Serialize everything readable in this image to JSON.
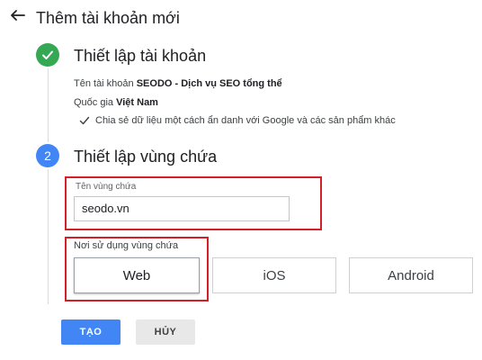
{
  "header": {
    "title": "Thêm tài khoản mới",
    "back_icon": "back-arrow-icon"
  },
  "steps": [
    {
      "number": "",
      "status": "complete",
      "title": "Thiết lập tài khoản",
      "account_label": "Tên tài khoản",
      "account_value": "SEODO - Dịch vụ SEO tổng thể",
      "country_label": "Quốc gia",
      "country_value": "Việt Nam",
      "share_text": "Chia sẻ dữ liệu một cách ẩn danh với Google và các sản phẩm khác"
    },
    {
      "number": "2",
      "status": "active",
      "title": "Thiết lập vùng chứa",
      "container_name_label": "Tên vùng chứa",
      "container_name_value": "seodo.vn",
      "usage_label": "Nơi sử dụng vùng chứa",
      "platforms": [
        "Web",
        "iOS",
        "Android"
      ],
      "selected_platform": "Web"
    }
  ],
  "actions": {
    "create_label": "TẠO",
    "cancel_label": "HỦY"
  },
  "colors": {
    "primary": "#4285f4",
    "success": "#34a853",
    "highlight_box": "#d32027"
  }
}
